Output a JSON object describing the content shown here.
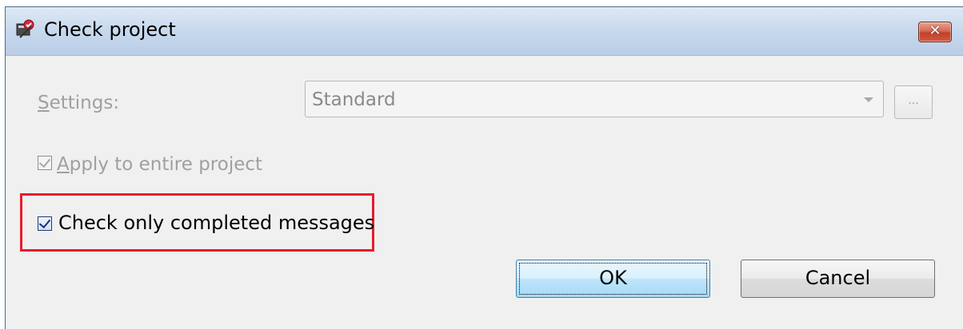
{
  "window": {
    "title": "Check project",
    "app_icon": "check-project-icon",
    "close_glyph": "✕"
  },
  "settings": {
    "label_prefix": "S",
    "label_rest": "ettings:",
    "selected_value": "Standard",
    "browse_label": "...",
    "enabled": false
  },
  "apply_option": {
    "label_prefix": "A",
    "label_rest": "pply to entire project",
    "checked": true,
    "enabled": false
  },
  "completed_option": {
    "label": "Check only completed messages",
    "checked": true,
    "enabled": true,
    "highlighted": true
  },
  "buttons": {
    "ok_label": "OK",
    "cancel_label": "Cancel"
  },
  "colors": {
    "highlight": "#e81c2a",
    "titlebar": "#c9daee",
    "close_button": "#c0412b",
    "disabled_text": "#a0a0a0"
  }
}
